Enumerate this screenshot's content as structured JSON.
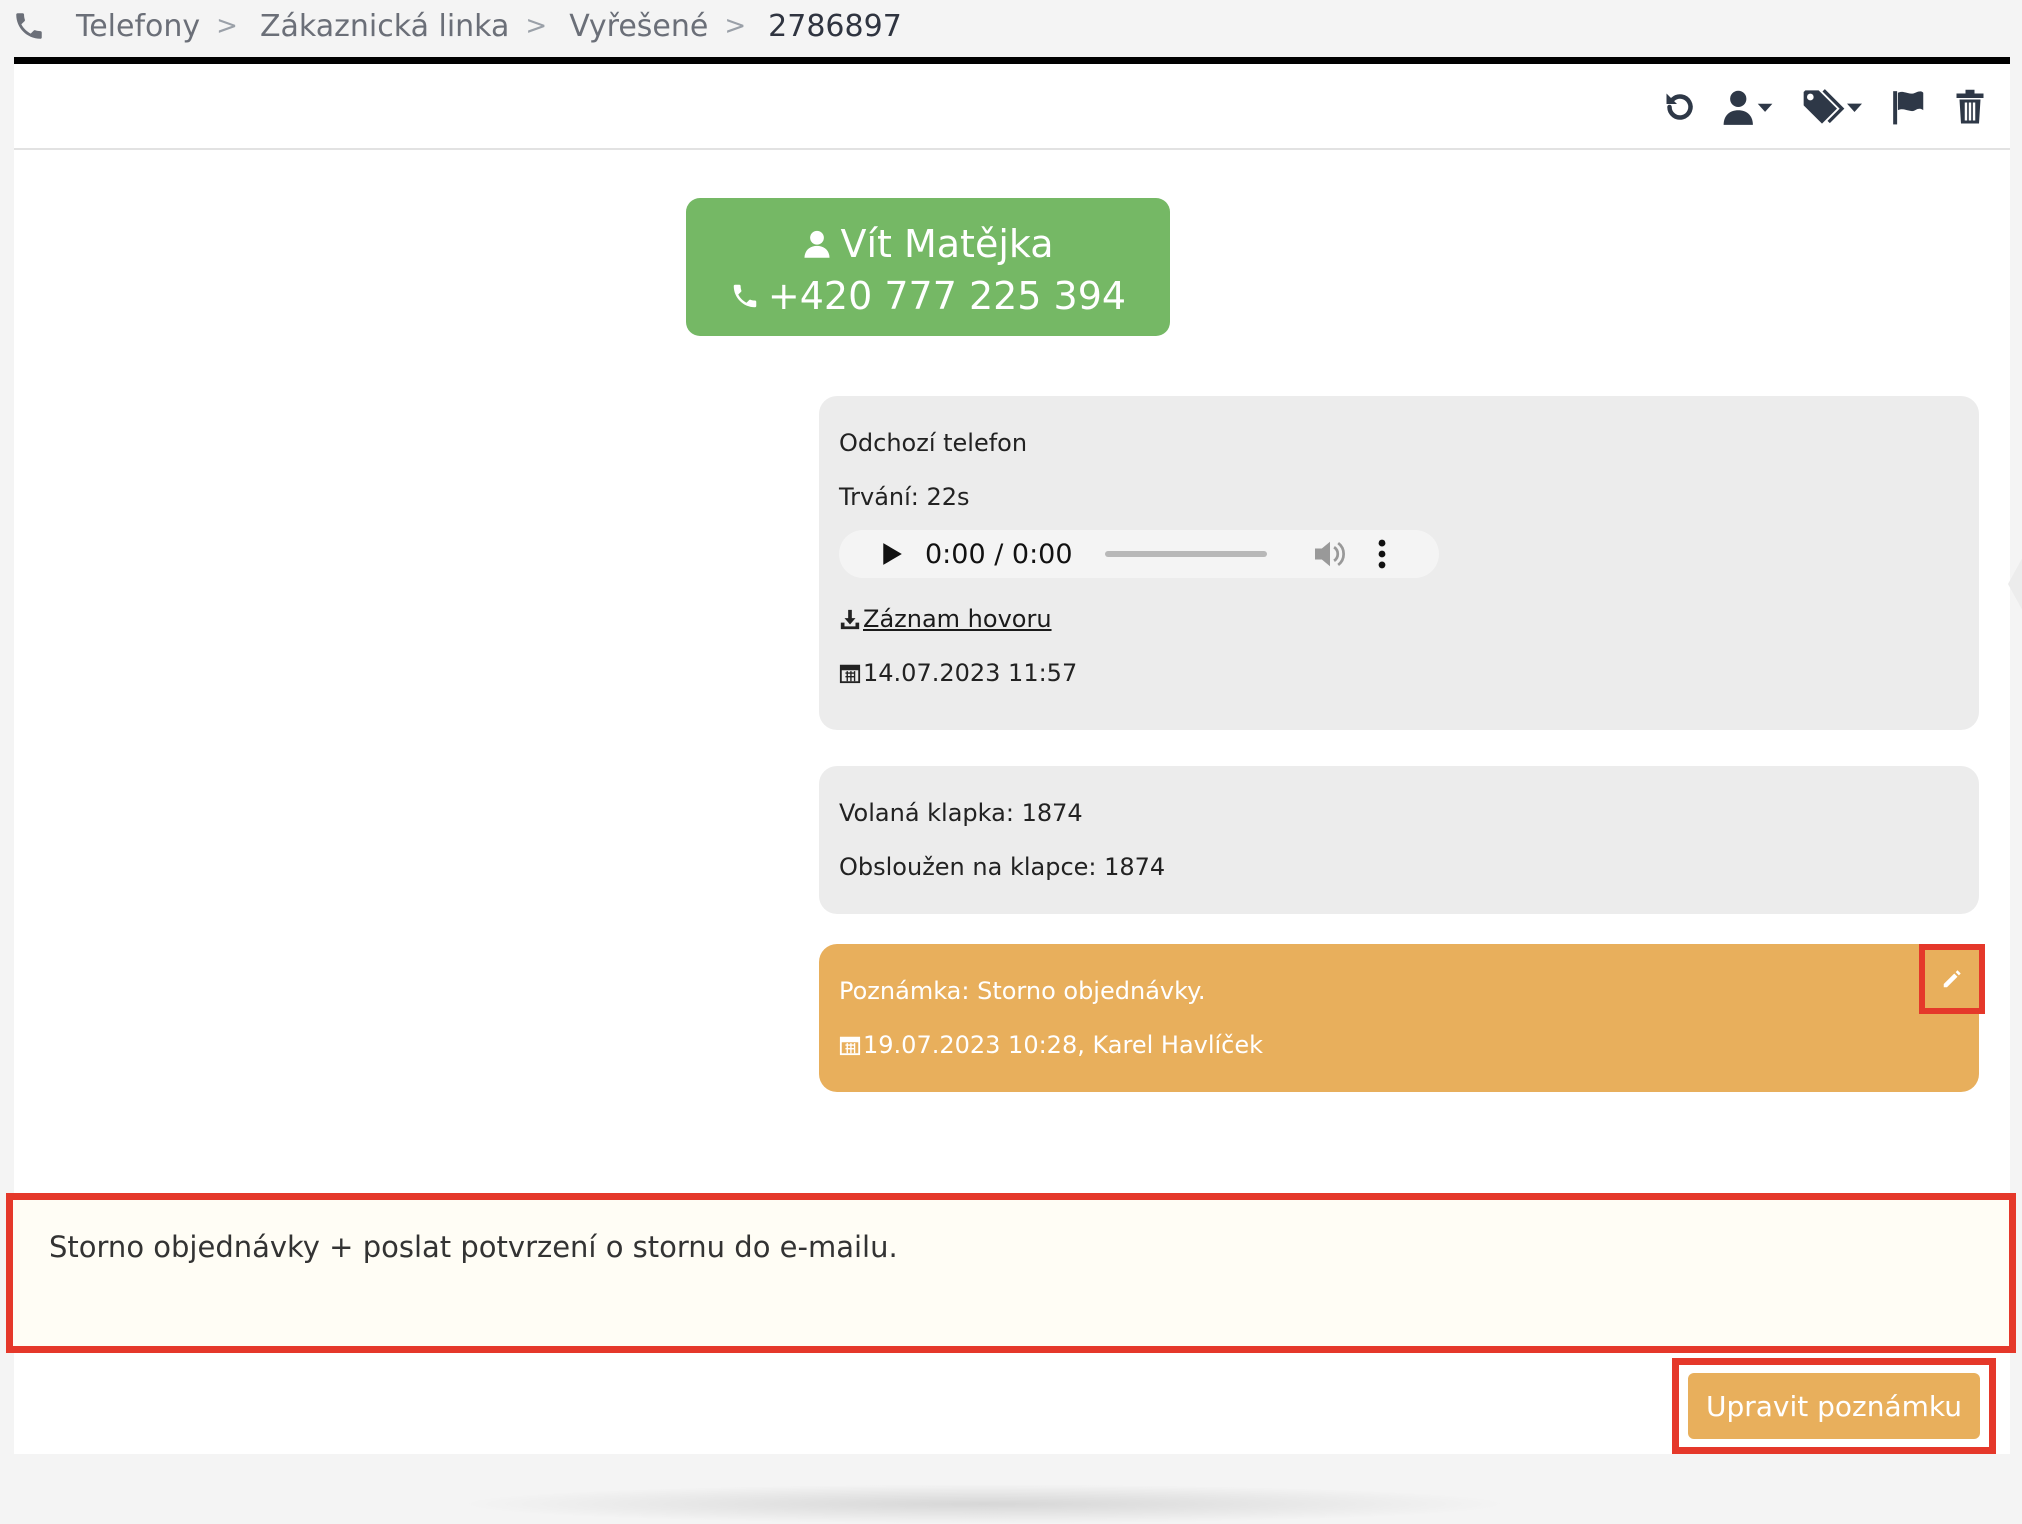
{
  "breadcrumb": {
    "items": [
      "Telefony",
      "Zákaznická linka",
      "Vyřešené"
    ],
    "separator": ">",
    "current": "2786897"
  },
  "toolbar": {
    "icons": [
      "refresh-icon",
      "assign-user-icon",
      "tags-icon",
      "flag-icon",
      "trash-icon"
    ]
  },
  "contact": {
    "name": "Vít Matějka",
    "phone": "+420 777 225 394",
    "color": "#75b865"
  },
  "call": {
    "type": "Odchozí telefon",
    "duration": "Trvání: 22s",
    "audio_time": "0:00 / 0:00",
    "recording_link": "Záznam hovoru",
    "datetime": "14.07.2023 11:57"
  },
  "extension": {
    "called": "Volaná klapka: 1874",
    "served": "Obsloužen na klapce: 1874"
  },
  "note": {
    "text": "Poznámka: Storno objednávky.",
    "meta": "19.07.2023 10:28, Karel Havlíček",
    "color": "#e8af5c"
  },
  "editor": {
    "value": "Storno objednávky + poslat potvrzení o stornu do e-mailu.",
    "submit_label": "Upravit poznámku"
  },
  "highlight_color": "#e5382a"
}
